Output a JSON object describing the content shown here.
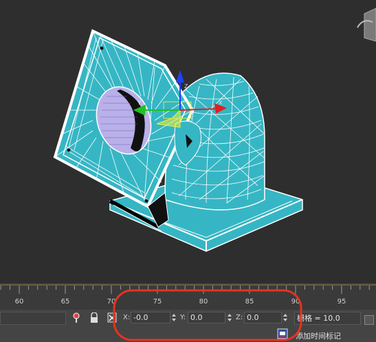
{
  "timeline": {
    "ticks": [
      "60",
      "65",
      "70",
      "75",
      "80",
      "85",
      "90",
      "95"
    ]
  },
  "coords": {
    "x_label": "X:",
    "x_value": "-0.0",
    "y_label": "Y:",
    "y_value": "0.0",
    "z_label": "Z:",
    "z_value": "0.0"
  },
  "grid": {
    "label": "栅格 = 10.0"
  },
  "add_time_tag": {
    "label": "添加时间标记"
  },
  "icons": {
    "key": "key-icon",
    "lock": "lock-icon",
    "absolute_mode": "absolute-mode-icon",
    "time_tag": "time-tag-icon",
    "viewcube": "viewcube-icon"
  },
  "colors": {
    "mesh": "#36b6c4",
    "wire": "#ffffff",
    "highlight": "#e8321e",
    "x_axis": "#e02020",
    "y_axis": "#20c020",
    "z_axis": "#2040ff"
  }
}
